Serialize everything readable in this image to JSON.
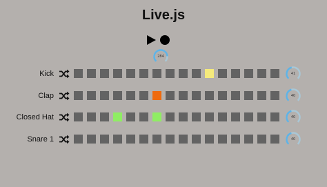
{
  "app": {
    "title": "Live.js"
  },
  "transport": {
    "play_icon": "play-icon",
    "record_icon": "record-icon",
    "tempo_value": "284",
    "tempo_level": 0.82
  },
  "colors": {
    "background": "#b4b0ad",
    "step_off": "#636363",
    "knob_track": "#a9c7d6",
    "knob_fill": "#5fb3e6"
  },
  "tracks": [
    {
      "name": "Kick",
      "shuffle_icon": "shuffle-icon",
      "steps": [
        0,
        0,
        0,
        0,
        0,
        0,
        0,
        0,
        0,
        0,
        1,
        0,
        0,
        0,
        0,
        0
      ],
      "step_color": "#f5ea7c",
      "volume": "41",
      "volume_level": 0.45
    },
    {
      "name": "Clap",
      "shuffle_icon": "shuffle-icon",
      "steps": [
        0,
        0,
        0,
        0,
        0,
        0,
        1,
        0,
        0,
        0,
        0,
        0,
        0,
        0,
        0,
        0
      ],
      "step_color": "#ef6a0d",
      "volume": "40",
      "volume_level": 0.44
    },
    {
      "name": "Closed Hat",
      "shuffle_icon": "shuffle-icon",
      "steps": [
        0,
        0,
        0,
        1,
        0,
        0,
        1,
        0,
        0,
        0,
        0,
        0,
        0,
        0,
        0,
        0
      ],
      "step_color": "#8fed63",
      "volume": "40",
      "volume_level": 0.44
    },
    {
      "name": "Snare 1",
      "shuffle_icon": "shuffle-icon",
      "steps": [
        0,
        0,
        0,
        0,
        0,
        0,
        0,
        0,
        0,
        0,
        0,
        0,
        0,
        0,
        0,
        0
      ],
      "step_color": "#636363",
      "volume": "40",
      "volume_level": 0.44
    }
  ]
}
